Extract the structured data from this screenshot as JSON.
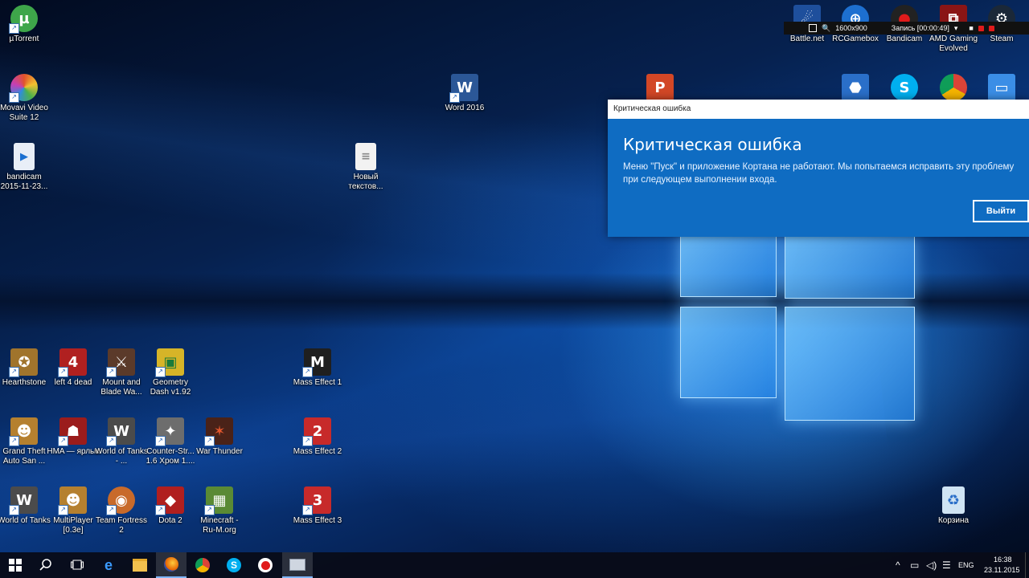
{
  "desktop_icons": [
    {
      "label": "µTorrent",
      "color": "#3ea64a",
      "glyph": "µ"
    },
    {
      "label": "Movavi Video Suite 12",
      "color": "#e2522c",
      "glyph": "✿"
    },
    {
      "label": "bandicam 2015-11-23...",
      "color": "#e8eef7",
      "glyph": "▶"
    },
    {
      "label": "Word 2016",
      "color": "#2b5797",
      "glyph": "W"
    },
    {
      "label": "Новый текстов...",
      "color": "#f2f2f2",
      "glyph": "≡"
    },
    {
      "label": "Hearthstone",
      "color": "#a0742c",
      "glyph": "✪"
    },
    {
      "label": "left 4 dead",
      "color": "#b02020",
      "glyph": "4"
    },
    {
      "label": "Mount and Blade Wa...",
      "color": "#5b3a2a",
      "glyph": "⚔"
    },
    {
      "label": "Geometry Dash v1.92",
      "color": "#d6b428",
      "glyph": "▣"
    },
    {
      "label": "Mass Effect 1",
      "color": "#1f1f1f",
      "glyph": "M"
    },
    {
      "label": "Grand Theft Auto San ...",
      "color": "#b5802f",
      "glyph": "☻"
    },
    {
      "label": "HMA — ярлык",
      "color": "#9b1c1c",
      "glyph": "☗"
    },
    {
      "label": "World of Tanks - ...",
      "color": "#4b4b4b",
      "glyph": "W"
    },
    {
      "label": "Counter-Str... 1.6 Хром 1....",
      "color": "#6d6d6d",
      "glyph": "✦"
    },
    {
      "label": "War Thunder",
      "color": "#4a2218",
      "glyph": "✶"
    },
    {
      "label": "Mass Effect 2",
      "color": "#c72a2a",
      "glyph": "2"
    },
    {
      "label": "World of Tanks",
      "color": "#4b4b4b",
      "glyph": "W"
    },
    {
      "label": "MultiPlayer [0.3e]",
      "color": "#b5802f",
      "glyph": "☻"
    },
    {
      "label": "Team Fortress 2",
      "color": "#c86a2a",
      "glyph": "◉"
    },
    {
      "label": "Dota 2",
      "color": "#b01f1f",
      "glyph": "◆"
    },
    {
      "label": "Minecraft - Ru-M.org",
      "color": "#5a8a34",
      "glyph": "▦"
    },
    {
      "label": "Mass Effect 3",
      "color": "#c72a2a",
      "glyph": "3"
    },
    {
      "label": "Корзина",
      "color": "#cfe4f4",
      "glyph": "♻"
    },
    {
      "label": "Battle.net",
      "color": "#1e4f9c",
      "glyph": "☄"
    },
    {
      "label": "RCGamebox",
      "color": "#1d6fd0",
      "glyph": "⊕"
    },
    {
      "label": "Bandicam",
      "color": "#222222",
      "glyph": "●"
    },
    {
      "label": "AMD Gaming Evolved",
      "color": "#8a1515",
      "glyph": "⧉"
    },
    {
      "label": "Steam",
      "color": "#1b2838",
      "glyph": "⚙"
    }
  ],
  "partial_icons": [
    {
      "name": "powerpoint",
      "color": "#d24726",
      "glyph": "P"
    },
    {
      "name": "app",
      "color": "#2a6fc9",
      "glyph": "⬣"
    },
    {
      "name": "skype",
      "color": "#00aff0",
      "glyph": "S"
    },
    {
      "name": "chrome",
      "color": "#db4437",
      "glyph": "◎"
    },
    {
      "name": "computer",
      "color": "#3b8ee6",
      "glyph": "▭"
    }
  ],
  "recorder": {
    "resolution": "1600x900",
    "status": "Запись [00:00:49]"
  },
  "dialog": {
    "window_title": "Критическая ошибка",
    "heading": "Критическая ошибка",
    "message": "Меню \"Пуск\" и приложение Кортана не работают. Мы попытаемся исправить эту проблему при следующем выполнении входа.",
    "button": "Выйти"
  },
  "taskbar": {
    "language": "ENG",
    "time": "16:38",
    "date": "23.11.2015"
  },
  "colors": {
    "dialog_bg": "#0f6cc2",
    "taskbar_bg": "#080c18"
  }
}
